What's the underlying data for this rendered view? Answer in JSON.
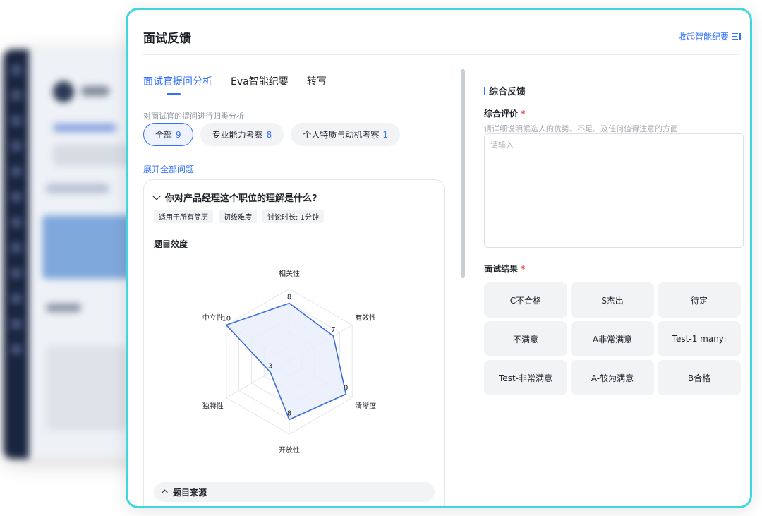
{
  "panel": {
    "title": "面试反馈",
    "collapse_label": "收起智能纪要"
  },
  "left": {
    "tabs": [
      {
        "label": "面试官提问分析",
        "active": true
      },
      {
        "label": "Eva智能纪要",
        "active": false
      },
      {
        "label": "转写",
        "active": false
      }
    ],
    "description": "对面试官的提问进行归类分析",
    "filters": [
      {
        "label": "全部",
        "count": "9",
        "active": true
      },
      {
        "label": "专业能力考察",
        "count": "8",
        "active": false
      },
      {
        "label": "个人特质与动机考察",
        "count": "1",
        "active": false
      }
    ],
    "expand_label": "展开全部问题",
    "question": {
      "title": "你对产品经理这个职位的理解是什么?",
      "tags": [
        "适用于所有简历",
        "初级难度",
        "讨论时长: 1分钟"
      ],
      "effect_title": "题目效度",
      "source_label": "题目来源"
    }
  },
  "chart_data": {
    "type": "radar",
    "axes": [
      "相关性",
      "有效性",
      "清晰度",
      "开放性",
      "独特性",
      "中立性"
    ],
    "values": [
      8,
      7,
      9,
      8,
      3,
      10
    ],
    "range": [
      0,
      10
    ],
    "grid_levels": 5,
    "color": "#3d6fd6",
    "fill": "#e9effa"
  },
  "right": {
    "section_title": "综合反馈",
    "eval_label": "综合评价",
    "eval_required": "*",
    "eval_hint": "请详细说明候选人的优势、不足、及任何值得注意的方面",
    "eval_placeholder": "请输入",
    "result_label": "面试结果",
    "result_required": "*",
    "results": [
      "C不合格",
      "S杰出",
      "待定",
      "不满意",
      "A非常满意",
      "Test-1 manyi",
      "Test-非常满意",
      "A-较为满意",
      "B合格"
    ]
  },
  "colors": {
    "accent": "#3370ff",
    "panel_border": "#3ed8dc",
    "required": "#f54a45"
  }
}
